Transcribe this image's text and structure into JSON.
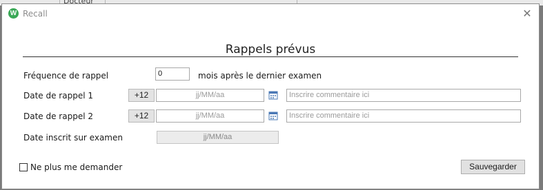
{
  "background": {
    "tab_fragment": "Docteur"
  },
  "window": {
    "title": "Recall",
    "icon_letter": "W",
    "close_glyph": "✕"
  },
  "form": {
    "heading": "Rappels prévus",
    "frequency": {
      "label": "Fréquence de rappel",
      "value": "0",
      "suffix": "mois après le dernier examen"
    },
    "recall_1": {
      "label": "Date de rappel 1",
      "plus_label": "+12",
      "date_placeholder": "jj/MM/aa",
      "comment_placeholder": "Inscrire commentaire ici"
    },
    "recall_2": {
      "label": "Date de rappel 2",
      "plus_label": "+12",
      "date_placeholder": "jj/MM/aa",
      "comment_placeholder": "Inscrire commentaire ici"
    },
    "exam_date": {
      "label": "Date inscrit sur examen",
      "placeholder": "jj/MM/aa"
    },
    "dont_ask": {
      "label": "Ne plus me demander",
      "checked": false
    },
    "save_label": "Sauvegarder"
  },
  "colors": {
    "app_icon": "#3aa856",
    "calendar_icon": "#4a78b5"
  }
}
